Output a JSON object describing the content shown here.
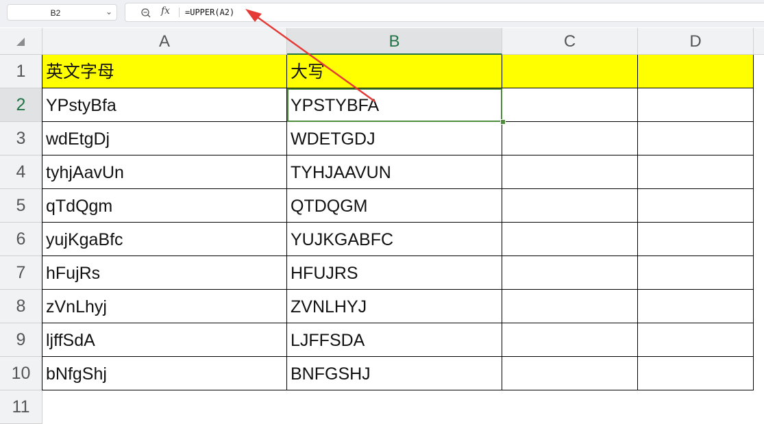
{
  "name_box": {
    "value": "B2"
  },
  "formula_bar": {
    "formula": "=UPPER(A2)"
  },
  "columns": [
    "A",
    "B",
    "C",
    "D"
  ],
  "selected_column": "B",
  "rows": [
    {
      "num": "1",
      "a": "英文字母",
      "b": "大写",
      "header": true
    },
    {
      "num": "2",
      "a": "YPstyBfa",
      "b": "YPSTYBFA"
    },
    {
      "num": "3",
      "a": "wdEtgDj",
      "b": "WDETGDJ"
    },
    {
      "num": "4",
      "a": "tyhjAavUn",
      "b": "TYHJAAVUN"
    },
    {
      "num": "5",
      "a": "qTdQgm",
      "b": "QTDQGM"
    },
    {
      "num": "6",
      "a": "yujKgaBfc",
      "b": "YUJKGABFC"
    },
    {
      "num": "7",
      "a": "hFujRs",
      "b": "HFUJRS"
    },
    {
      "num": "8",
      "a": "zVnLhyj",
      "b": "ZVNLHYJ"
    },
    {
      "num": "9",
      "a": "ljffSdA",
      "b": "LJFFSDA"
    },
    {
      "num": "10",
      "a": "bNfgShj",
      "b": "BNFGSHJ"
    },
    {
      "num": "11",
      "a": "",
      "b": ""
    }
  ],
  "colors": {
    "header_fill": "#ffff00",
    "selection": "#217346",
    "arrow": "#e53935"
  }
}
